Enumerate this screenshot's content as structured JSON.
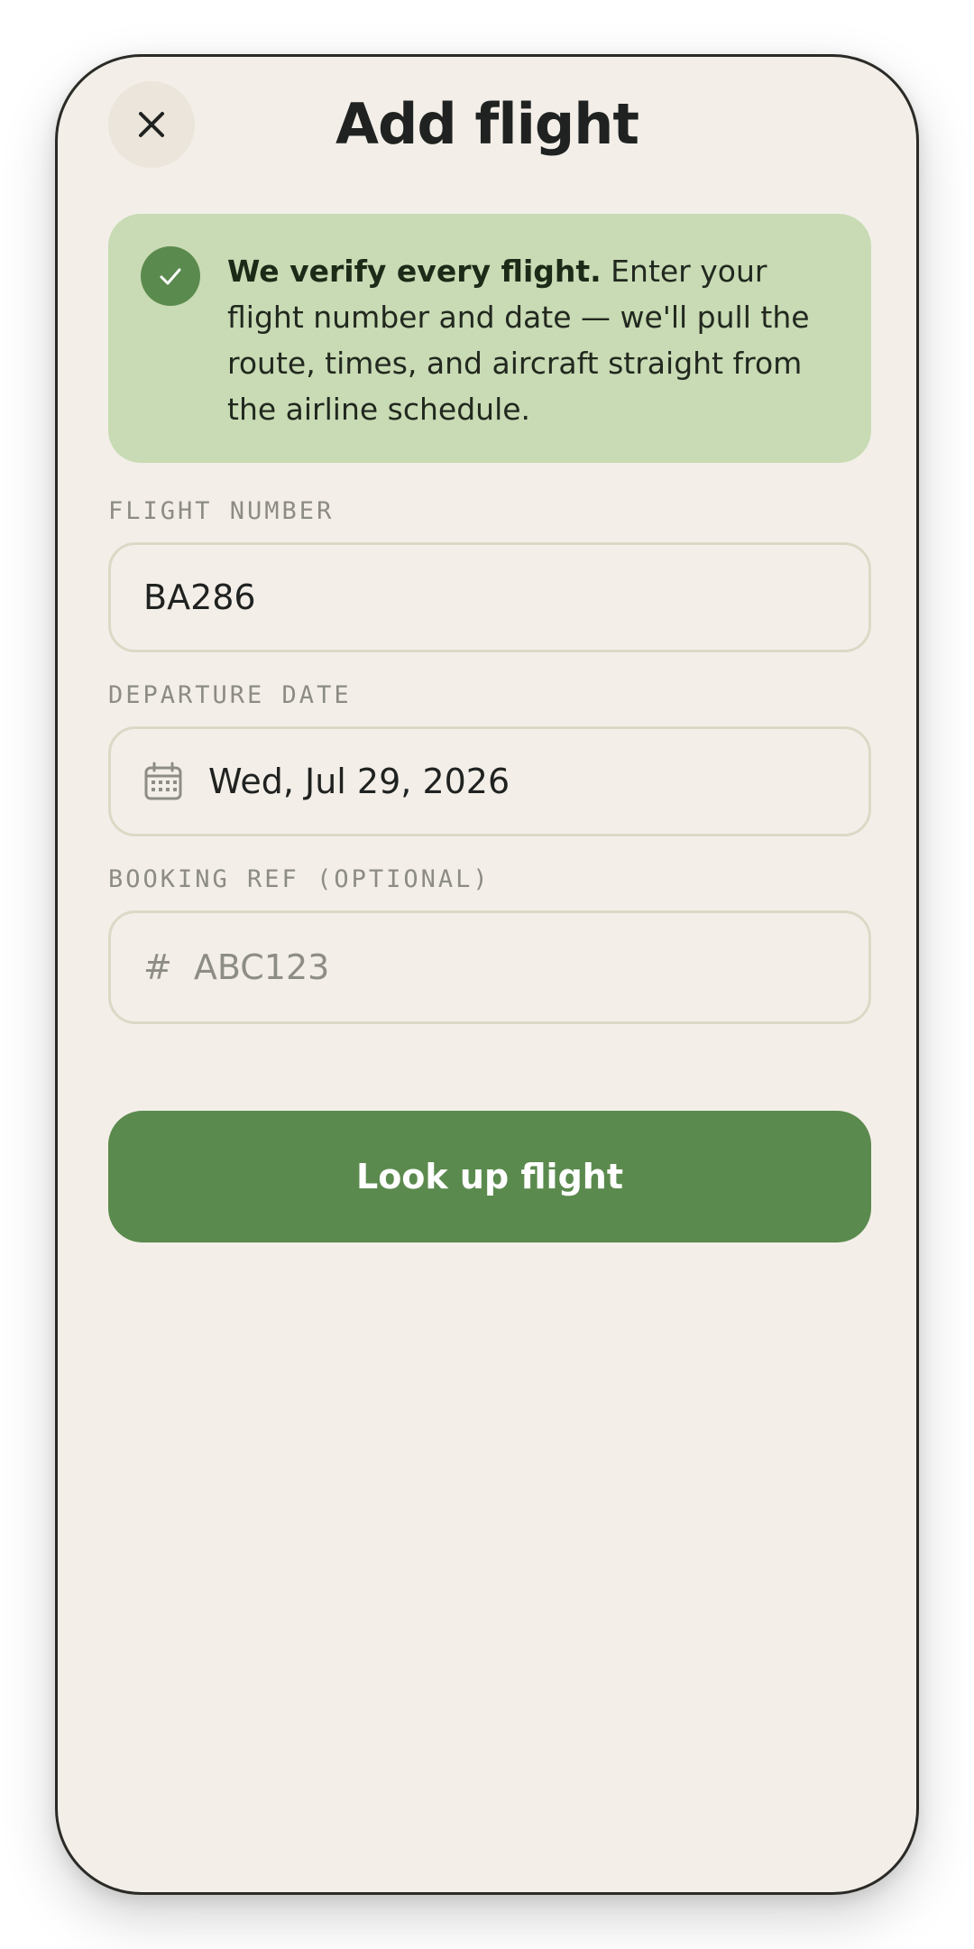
{
  "header": {
    "title": "Add flight",
    "close_icon": "close-icon"
  },
  "notice": {
    "icon": "check-circle-icon",
    "bold_text": "We verify every flight.",
    "body_text": " Enter your flight number and date — we'll pull the route, times, and aircraft straight from the airline schedule."
  },
  "fields": {
    "flight_number": {
      "label": "FLIGHT NUMBER",
      "value": "BA286"
    },
    "departure_date": {
      "label": "DEPARTURE DATE",
      "icon": "calendar-icon",
      "value": "Wed, Jul 29, 2026"
    },
    "booking_ref": {
      "label": "BOOKING REF (OPTIONAL)",
      "prefix": "#",
      "placeholder": "ABC123",
      "value": ""
    }
  },
  "actions": {
    "submit_label": "Look up flight"
  },
  "colors": {
    "background": "#f3efe8",
    "accent": "#5b8a4e",
    "notice_background": "#c8dbb4",
    "field_border": "#ddd8c6"
  }
}
